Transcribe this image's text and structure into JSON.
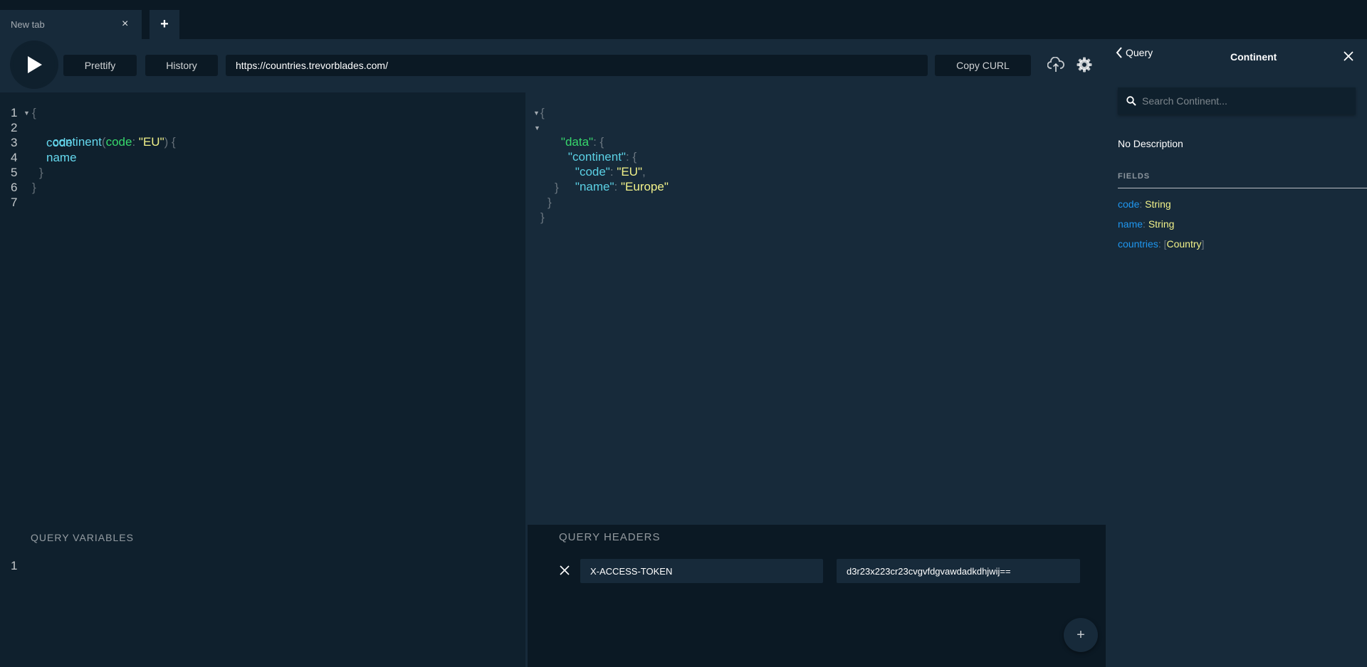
{
  "tabs": {
    "items": [
      {
        "label": "New tab",
        "close": "×"
      }
    ],
    "add_label": "+"
  },
  "toolbar": {
    "prettify_label": "Prettify",
    "history_label": "History",
    "url": "https://countries.trevorblades.com/",
    "copy_curl_label": "Copy CURL"
  },
  "editor": {
    "line_numbers": [
      "1",
      "2",
      "3",
      "4",
      "5",
      "6",
      "7"
    ],
    "open_brace": "{",
    "field": "continent",
    "paren_open": "(",
    "arg_name": "code",
    "colon": ":",
    "arg_value": "\"EU\"",
    "paren_close": ")",
    "inner_open": "{",
    "sub_field_1": "code",
    "sub_field_2": "name",
    "inner_close": "}",
    "close_brace": "}"
  },
  "result": {
    "open_brace": "{",
    "data_key": "\"data\"",
    "colon": ":",
    "data_open": "{",
    "continent_key": "\"continent\"",
    "continent_open": "{",
    "code_key": "\"code\"",
    "code_value": "\"EU\"",
    "comma": ",",
    "name_key": "\"name\"",
    "name_value": "\"Europe\"",
    "continent_close": "}",
    "data_close": "}",
    "close_brace": "}"
  },
  "variables": {
    "title": "QUERY VARIABLES",
    "line_numbers": [
      "1"
    ]
  },
  "headers": {
    "title": "QUERY HEADERS",
    "key": "X-ACCESS-TOKEN",
    "value": "d3r23x223cr23cvgvfdgvawdadkdhjwij==",
    "add_label": "+"
  },
  "docs": {
    "back_label": "Query",
    "title": "Continent",
    "search_placeholder": "Search Continent...",
    "description": "No Description",
    "fields_heading": "FIELDS",
    "fields": [
      {
        "name": "code",
        "sep": ":",
        "type": "String"
      },
      {
        "name": "name",
        "sep": ":",
        "type": "String"
      },
      {
        "name": "countries",
        "sep": ":",
        "open": "[",
        "type": "Country",
        "close": "]"
      }
    ]
  },
  "colors": {
    "background": "#0b1924",
    "panel": "#172a3a",
    "editor": "#0f202d",
    "field": "#65d8ee",
    "argument": "#37d76c",
    "string": "#f2f28a",
    "link": "#1f97f0"
  }
}
